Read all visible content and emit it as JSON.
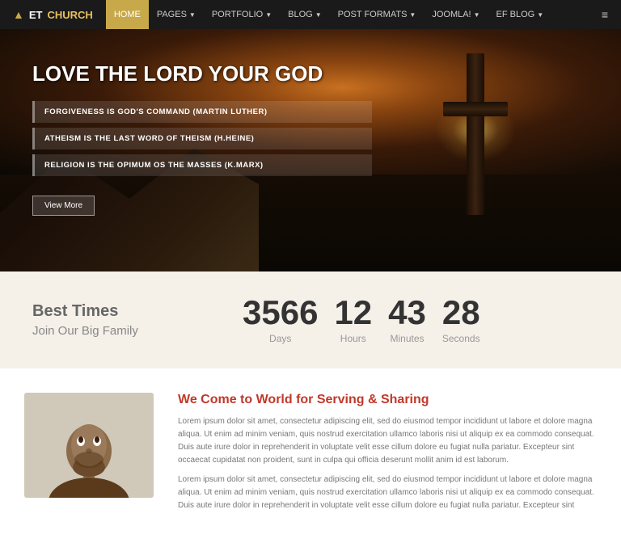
{
  "navbar": {
    "logo_icon": "▲",
    "logo_et": "ET",
    "logo_church": "CHURCH",
    "items": [
      {
        "label": "HOME",
        "active": true,
        "has_caret": false
      },
      {
        "label": "PAGES",
        "active": false,
        "has_caret": true
      },
      {
        "label": "PORTFOLIO",
        "active": false,
        "has_caret": true
      },
      {
        "label": "BLOG",
        "active": false,
        "has_caret": true
      },
      {
        "label": "POST FORMATS",
        "active": false,
        "has_caret": true
      },
      {
        "label": "JOOMLA!",
        "active": false,
        "has_caret": true
      },
      {
        "label": "EF BLOG",
        "active": false,
        "has_caret": true
      }
    ],
    "hamburger": "≡"
  },
  "hero": {
    "title": "LOVE THE LORD YOUR GOD",
    "quotes": [
      "FORGIVENESS IS GOD'S COMMAND (Martin Luther)",
      "ATHEISM IS THE LAST WORD OF THEISM (H.Heine)",
      "RELIGION IS THE OPIMUM OS THE MASSES (K.Marx)"
    ],
    "button_label": "View More"
  },
  "countdown": {
    "title": "Best Times",
    "subtitle": "Join Our Big Family",
    "items": [
      {
        "number": "3566",
        "label": "Days"
      },
      {
        "number": "12",
        "label": "Hours"
      },
      {
        "number": "43",
        "label": "Minutes"
      },
      {
        "number": "28",
        "label": "Seconds"
      }
    ]
  },
  "about": {
    "title": "We Come to World for Serving & Sharing",
    "paragraph1": "Lorem ipsum dolor sit amet, consectetur adipiscing elit, sed do eiusmod tempor incididunt ut labore et dolore magna aliqua. Ut enim ad minim veniam, quis nostrud exercitation ullamco laboris nisi ut aliquip ex ea commodo consequat. Duis aute irure dolor in reprehenderit in voluptate velit esse cillum dolore eu fugiat nulla pariatur. Excepteur sint occaecat cupidatat non proident, sunt in culpa qui officia deserunt mollit anim id est laborum.",
    "paragraph2": "Lorem ipsum dolor sit amet, consectetur adipiscing elit, sed do eiusmod tempor incididunt ut labore et dolore magna aliqua. Ut enim ad minim veniam, quis nostrud exercitation ullamco laboris nisi ut aliquip ex ea commodo consequat. Duis aute irure dolor in reprehenderit in voluptate velit esse cillum dolore eu fugiat nulla pariatur. Excepteur sint"
  }
}
